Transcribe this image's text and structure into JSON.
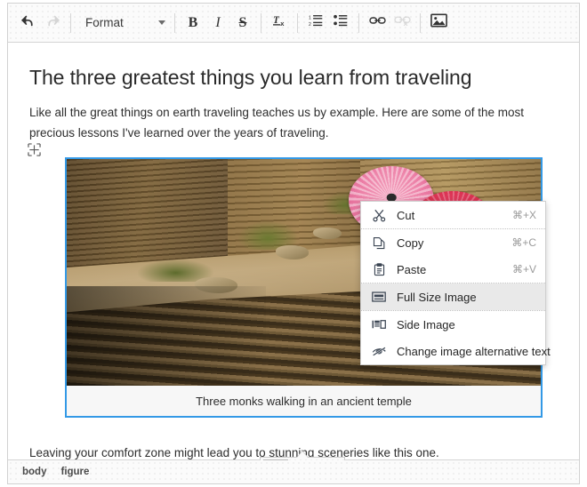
{
  "toolbar": {
    "undo_label": "undo-icon",
    "redo_label": "redo-icon",
    "format_label": "Format",
    "bold_label": "B",
    "italic_label": "I",
    "strike_label": "S",
    "remove_format_label": "Tx",
    "numbered_list_label": "numbered-list-icon",
    "bulleted_list_label": "bulleted-list-icon",
    "link_label": "link-icon",
    "unlink_label": "unlink-icon",
    "image_label": "image-icon"
  },
  "document": {
    "title": "The three greatest things you learn from traveling",
    "paragraph_1": "Like all the great things on earth traveling teaches us by example. Here are some of the most precious lessons I've learned over the years of traveling.",
    "figure_caption": "Three monks walking in an ancient temple",
    "paragraph_2": "Leaving your comfort zone might lead you to stunning sceneries like this one.",
    "selection_color": "#3399e6"
  },
  "context_menu": {
    "items": [
      {
        "label": "Cut",
        "shortcut": "⌘+X",
        "icon": "scissors-icon",
        "selected": false
      },
      {
        "label": "Copy",
        "shortcut": "⌘+C",
        "icon": "copy-icon",
        "selected": false
      },
      {
        "label": "Paste",
        "shortcut": "⌘+V",
        "icon": "clipboard-icon",
        "selected": false
      },
      {
        "label": "Full Size Image",
        "shortcut": "",
        "icon": "full-size-image-icon",
        "selected": true
      },
      {
        "label": "Side Image",
        "shortcut": "",
        "icon": "side-image-icon",
        "selected": false
      },
      {
        "label": "Change image alternative text",
        "shortcut": "",
        "icon": "eye-slash-icon",
        "selected": false
      }
    ],
    "highlight_color": "#e9e9e9"
  },
  "balloon_toolbar": {
    "buttons": [
      {
        "name": "full-size-image",
        "icon": "full-size-image-icon",
        "active": true
      },
      {
        "name": "side-image",
        "icon": "side-image-icon",
        "active": false
      },
      {
        "name": "change-alt-text",
        "icon": "eye-slash-icon",
        "active": false
      }
    ]
  },
  "statusbar": {
    "path": [
      "body",
      "figure"
    ]
  }
}
